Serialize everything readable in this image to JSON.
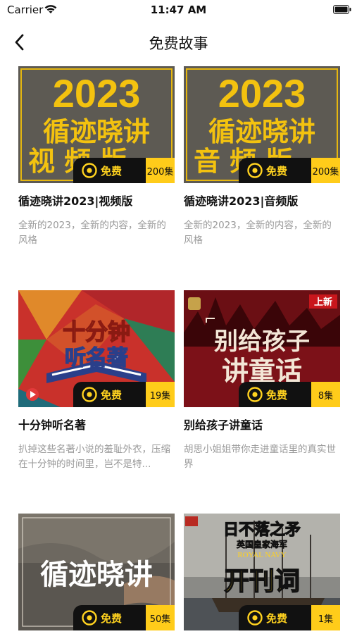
{
  "status_bar": {
    "carrier": "Carrier",
    "time": "11:47 AM"
  },
  "nav": {
    "title": "免费故事"
  },
  "free_label": "免费",
  "cards": [
    {
      "title": "循迹晓讲2023|视频版",
      "description": "全新的2023，全新的内容，全新的风格",
      "episodes": "200集",
      "cover_text": [
        "2023",
        "循迹晓讲",
        "视 频 版"
      ]
    },
    {
      "title": "循迹晓讲2023|音频版",
      "description": "全新的2023，全新的内容，全新的风格",
      "episodes": "200集",
      "cover_text": [
        "2023",
        "循迹晓讲",
        "音 频 版"
      ]
    },
    {
      "title": "十分钟听名著",
      "description": "扒掉这些名著小说的羞耻外衣，压缩在十分钟的时间里，岂不是特...",
      "episodes": "19集",
      "cover_text": [
        "十分钟",
        "听名著"
      ]
    },
    {
      "title": "别给孩子讲童话",
      "description": "胡思小姐姐带你走进童话里的真实世界",
      "episodes": "8集",
      "cover_text": [
        "别给孩子",
        "讲童话",
        "上新"
      ]
    },
    {
      "title": "",
      "description": "",
      "episodes": "50集",
      "cover_text": [
        "循迹晓讲"
      ]
    },
    {
      "title": "",
      "description": "",
      "episodes": "1集",
      "cover_text": [
        "日不落之矛",
        "英国皇家海军",
        "ROYAL NAVY",
        "开刊词"
      ]
    }
  ],
  "colors": {
    "accent": "#ffcc1a",
    "badge_bg": "#111111",
    "desc_gray": "#9a9a9a"
  }
}
